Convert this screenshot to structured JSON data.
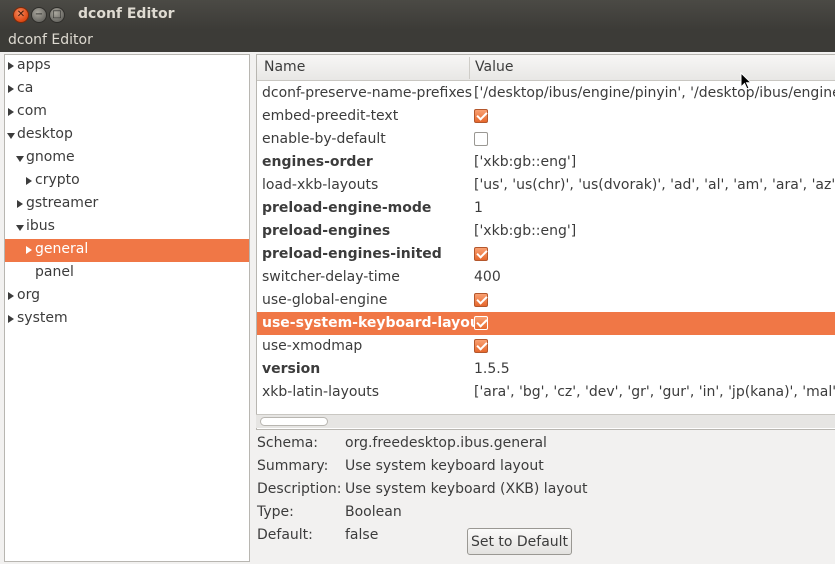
{
  "window": {
    "title": "dconf Editor",
    "app_label": "dconf Editor"
  },
  "tree": {
    "items": [
      {
        "label": "apps",
        "expander": "right",
        "depth": 0
      },
      {
        "label": "ca",
        "expander": "right",
        "depth": 0
      },
      {
        "label": "com",
        "expander": "right",
        "depth": 0
      },
      {
        "label": "desktop",
        "expander": "down",
        "depth": 0
      },
      {
        "label": "gnome",
        "expander": "down",
        "depth": 1
      },
      {
        "label": "crypto",
        "expander": "right",
        "depth": 2
      },
      {
        "label": "gstreamer",
        "expander": "right",
        "depth": 1
      },
      {
        "label": "ibus",
        "expander": "down",
        "depth": 1
      },
      {
        "label": "general",
        "expander": "right",
        "depth": 2,
        "selected": true
      },
      {
        "label": "panel",
        "expander": "none",
        "depth": 2
      },
      {
        "label": "org",
        "expander": "right",
        "depth": 0
      },
      {
        "label": "system",
        "expander": "right",
        "depth": 0
      }
    ]
  },
  "keys": {
    "columns": {
      "name": "Name",
      "value": "Value"
    },
    "rows": [
      {
        "name": "dconf-preserve-name-prefixes",
        "bold": false,
        "type": "text",
        "value": "['/desktop/ibus/engine/pinyin', '/desktop/ibus/engine/"
      },
      {
        "name": "embed-preedit-text",
        "bold": false,
        "type": "check",
        "checked": true
      },
      {
        "name": "enable-by-default",
        "bold": false,
        "type": "check",
        "checked": false
      },
      {
        "name": "engines-order",
        "bold": true,
        "type": "text",
        "value": "['xkb:gb::eng']"
      },
      {
        "name": "load-xkb-layouts",
        "bold": false,
        "type": "text",
        "value": "['us', 'us(chr)', 'us(dvorak)', 'ad', 'al', 'am', 'ara', 'az', 'ba"
      },
      {
        "name": "preload-engine-mode",
        "bold": true,
        "type": "text",
        "value": "1"
      },
      {
        "name": "preload-engines",
        "bold": true,
        "type": "text",
        "value": "['xkb:gb::eng']"
      },
      {
        "name": "preload-engines-inited",
        "bold": true,
        "type": "check",
        "checked": true
      },
      {
        "name": "switcher-delay-time",
        "bold": false,
        "type": "text",
        "value": "400"
      },
      {
        "name": "use-global-engine",
        "bold": false,
        "type": "check",
        "checked": true
      },
      {
        "name": "use-system-keyboard-layout",
        "bold": true,
        "type": "check",
        "checked": true,
        "selected": true
      },
      {
        "name": "use-xmodmap",
        "bold": false,
        "type": "check",
        "checked": true
      },
      {
        "name": "version",
        "bold": true,
        "type": "text",
        "value": "1.5.5"
      },
      {
        "name": "xkb-latin-layouts",
        "bold": false,
        "type": "text",
        "value": "['ara', 'bg', 'cz', 'dev', 'gr', 'gur', 'in', 'jp(kana)', 'mal', 'm"
      }
    ]
  },
  "details": {
    "schema_label": "Schema:",
    "schema": "org.freedesktop.ibus.general",
    "summary_label": "Summary:",
    "summary": "Use system keyboard layout",
    "description_label": "Description:",
    "description": "Use system keyboard (XKB) layout",
    "type_label": "Type:",
    "type": "Boolean",
    "default_label": "Default:",
    "default": "false",
    "set_default_button": "Set to Default"
  },
  "colors": {
    "selection": "#f07746",
    "titlebar": "#3c3b37",
    "close_button": "#dd4814"
  },
  "icons": {
    "close": "close-icon",
    "minimize": "minimize-icon",
    "maximize": "maximize-icon",
    "cursor": "mouse-pointer-icon"
  }
}
